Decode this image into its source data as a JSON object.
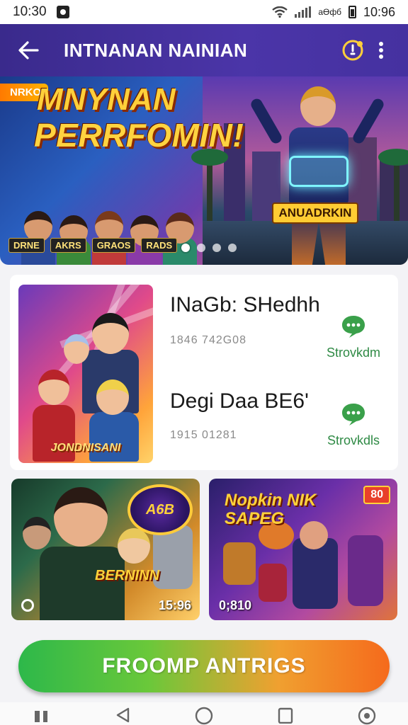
{
  "status_bar": {
    "time_left": "10:30",
    "network_text": "аӨфб",
    "time_right": "10:96"
  },
  "app_bar": {
    "title": "INTNANAN NAINIAN",
    "icons": [
      "back-arrow-icon",
      "notification-icon",
      "more-vert-icon"
    ]
  },
  "hero": {
    "badge": "NRKO",
    "title_line1": "MNYNAN",
    "title_line2": "PERRFOMIN!",
    "sign": "ANUADRKIN",
    "labels": [
      "DRNE",
      "AKRS",
      "GRAOS",
      "RADS"
    ],
    "carousel": {
      "count": 4,
      "active": 0
    }
  },
  "featured": {
    "art_label": "JONDNISANI",
    "items": [
      {
        "title": "INaGb: SHedhh",
        "meta": "1846 742G08",
        "action_label": "Strovkdm"
      },
      {
        "title": "Degi Daa BE6'",
        "meta": "1915 01281",
        "action_label": "Strovkdls"
      }
    ]
  },
  "tiles": [
    {
      "title": "BERNINN",
      "logo": "A6B",
      "time": "15:96"
    },
    {
      "title": "Nopkin NIK SAPEG",
      "badge": "80",
      "time": "0;810"
    }
  ],
  "cta": {
    "label": "FROOMP ANTRIGS"
  },
  "colors": {
    "app_bar": "#3a2a8c",
    "accent_green": "#2f8a45",
    "cta_start": "#2db84a",
    "cta_end": "#f56a1c"
  },
  "nav_bar": {
    "icons": [
      "recents-icon",
      "back-triangle-icon",
      "home-circle-icon",
      "overview-square-icon",
      "assistant-icon"
    ]
  }
}
